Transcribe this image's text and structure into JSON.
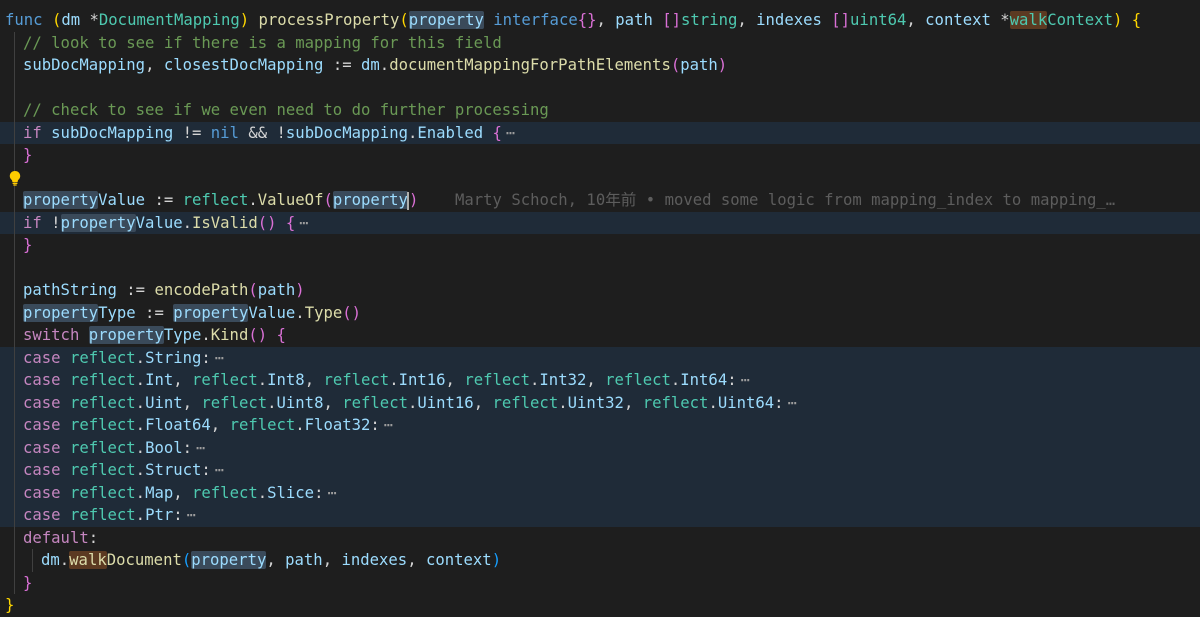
{
  "editor": {
    "lines": [
      {
        "segments": [
          {
            "t": "func ",
            "c": "kw"
          },
          {
            "t": "(",
            "c": "p1"
          },
          {
            "t": "dm ",
            "c": "var"
          },
          {
            "t": "*",
            "c": "op"
          },
          {
            "t": "DocumentMapping",
            "c": "ty"
          },
          {
            "t": ") ",
            "c": "p1"
          },
          {
            "t": "processProperty",
            "c": "fn"
          },
          {
            "t": "(",
            "c": "p1"
          },
          {
            "t": "property",
            "c": "var sel"
          },
          {
            "t": " interface",
            "c": "kw"
          },
          {
            "t": "{}",
            "c": "p2"
          },
          {
            "t": ", ",
            "c": "op"
          },
          {
            "t": "path ",
            "c": "var"
          },
          {
            "t": "[]",
            "c": "p2"
          },
          {
            "t": "string",
            "c": "ty"
          },
          {
            "t": ", ",
            "c": "op"
          },
          {
            "t": "indexes ",
            "c": "var"
          },
          {
            "t": "[]",
            "c": "p2"
          },
          {
            "t": "uint64",
            "c": "ty"
          },
          {
            "t": ", ",
            "c": "op"
          },
          {
            "t": "context ",
            "c": "var"
          },
          {
            "t": "*",
            "c": "op"
          },
          {
            "t": "walk",
            "c": "ty sel2"
          },
          {
            "t": "Context",
            "c": "ty"
          },
          {
            "t": ") ",
            "c": "p1"
          },
          {
            "t": "{",
            "c": "p1"
          }
        ]
      },
      {
        "segments": [
          {
            "t": "// look to see if there is a mapping for this field",
            "c": "cm"
          }
        ]
      },
      {
        "segments": [
          {
            "t": "subDocMapping",
            "c": "var"
          },
          {
            "t": ", ",
            "c": "op"
          },
          {
            "t": "closestDocMapping",
            "c": "var"
          },
          {
            "t": " := ",
            "c": "op"
          },
          {
            "t": "dm",
            "c": "var"
          },
          {
            "t": ".",
            "c": "op"
          },
          {
            "t": "documentMappingForPathElements",
            "c": "fn"
          },
          {
            "t": "(",
            "c": "p2"
          },
          {
            "t": "path",
            "c": "var"
          },
          {
            "t": ")",
            "c": "p2"
          }
        ]
      },
      {
        "segments": []
      },
      {
        "segments": [
          {
            "t": "// check to see if we even need to do further processing",
            "c": "cm"
          }
        ]
      },
      {
        "fold": true,
        "segments": [
          {
            "t": "if ",
            "c": "ctl"
          },
          {
            "t": "subDocMapping",
            "c": "var"
          },
          {
            "t": " != ",
            "c": "op"
          },
          {
            "t": "nil",
            "c": "kw"
          },
          {
            "t": " && !",
            "c": "op"
          },
          {
            "t": "subDocMapping",
            "c": "var"
          },
          {
            "t": ".",
            "c": "op"
          },
          {
            "t": "Enabled",
            "c": "var"
          },
          {
            "t": " {",
            "c": "p2"
          }
        ]
      },
      {
        "segments": [
          {
            "t": "}",
            "c": "p2"
          }
        ]
      },
      {
        "bulb": true,
        "segments": []
      },
      {
        "blame": "Marty Schoch, 10年前 • moved some logic from mapping_index to mapping_…",
        "segments": [
          {
            "t": "property",
            "c": "var sel"
          },
          {
            "t": "Value",
            "c": "var"
          },
          {
            "t": " := ",
            "c": "op"
          },
          {
            "t": "reflect",
            "c": "ty"
          },
          {
            "t": ".",
            "c": "op"
          },
          {
            "t": "ValueOf",
            "c": "fn"
          },
          {
            "t": "(",
            "c": "p2"
          },
          {
            "t": "property",
            "c": "var sel"
          },
          {
            "t": ")",
            "c": "p2"
          }
        ]
      },
      {
        "fold": true,
        "segments": [
          {
            "t": "if ",
            "c": "ctl"
          },
          {
            "t": "!",
            "c": "op"
          },
          {
            "t": "property",
            "c": "var sel"
          },
          {
            "t": "Value",
            "c": "var"
          },
          {
            "t": ".",
            "c": "op"
          },
          {
            "t": "IsValid",
            "c": "fn"
          },
          {
            "t": "()",
            "c": "p2"
          },
          {
            "t": " {",
            "c": "p2"
          }
        ]
      },
      {
        "segments": [
          {
            "t": "}",
            "c": "p2"
          }
        ]
      },
      {
        "segments": []
      },
      {
        "segments": [
          {
            "t": "pathString",
            "c": "var"
          },
          {
            "t": " := ",
            "c": "op"
          },
          {
            "t": "encodePath",
            "c": "fn"
          },
          {
            "t": "(",
            "c": "p2"
          },
          {
            "t": "path",
            "c": "var"
          },
          {
            "t": ")",
            "c": "p2"
          }
        ]
      },
      {
        "segments": [
          {
            "t": "property",
            "c": "var sel"
          },
          {
            "t": "Type",
            "c": "var"
          },
          {
            "t": " := ",
            "c": "op"
          },
          {
            "t": "property",
            "c": "var sel"
          },
          {
            "t": "Value",
            "c": "var"
          },
          {
            "t": ".",
            "c": "op"
          },
          {
            "t": "Type",
            "c": "fn"
          },
          {
            "t": "()",
            "c": "p2"
          }
        ]
      },
      {
        "segments": [
          {
            "t": "switch ",
            "c": "ctl"
          },
          {
            "t": "property",
            "c": "var sel"
          },
          {
            "t": "Type",
            "c": "var"
          },
          {
            "t": ".",
            "c": "op"
          },
          {
            "t": "Kind",
            "c": "fn"
          },
          {
            "t": "()",
            "c": "p2"
          },
          {
            "t": " {",
            "c": "p2"
          }
        ]
      },
      {
        "fold": true,
        "segments": [
          {
            "t": "case ",
            "c": "ctl"
          },
          {
            "t": "reflect",
            "c": "ty"
          },
          {
            "t": ".",
            "c": "op"
          },
          {
            "t": "String",
            "c": "var"
          },
          {
            "t": ":",
            "c": "op"
          }
        ]
      },
      {
        "fold": true,
        "segments": [
          {
            "t": "case ",
            "c": "ctl"
          },
          {
            "t": "reflect",
            "c": "ty"
          },
          {
            "t": ".",
            "c": "op"
          },
          {
            "t": "Int",
            "c": "var"
          },
          {
            "t": ", ",
            "c": "op"
          },
          {
            "t": "reflect",
            "c": "ty"
          },
          {
            "t": ".",
            "c": "op"
          },
          {
            "t": "Int8",
            "c": "var"
          },
          {
            "t": ", ",
            "c": "op"
          },
          {
            "t": "reflect",
            "c": "ty"
          },
          {
            "t": ".",
            "c": "op"
          },
          {
            "t": "Int16",
            "c": "var"
          },
          {
            "t": ", ",
            "c": "op"
          },
          {
            "t": "reflect",
            "c": "ty"
          },
          {
            "t": ".",
            "c": "op"
          },
          {
            "t": "Int32",
            "c": "var"
          },
          {
            "t": ", ",
            "c": "op"
          },
          {
            "t": "reflect",
            "c": "ty"
          },
          {
            "t": ".",
            "c": "op"
          },
          {
            "t": "Int64",
            "c": "var"
          },
          {
            "t": ":",
            "c": "op"
          }
        ]
      },
      {
        "fold": true,
        "segments": [
          {
            "t": "case ",
            "c": "ctl"
          },
          {
            "t": "reflect",
            "c": "ty"
          },
          {
            "t": ".",
            "c": "op"
          },
          {
            "t": "Uint",
            "c": "var"
          },
          {
            "t": ", ",
            "c": "op"
          },
          {
            "t": "reflect",
            "c": "ty"
          },
          {
            "t": ".",
            "c": "op"
          },
          {
            "t": "Uint8",
            "c": "var"
          },
          {
            "t": ", ",
            "c": "op"
          },
          {
            "t": "reflect",
            "c": "ty"
          },
          {
            "t": ".",
            "c": "op"
          },
          {
            "t": "Uint16",
            "c": "var"
          },
          {
            "t": ", ",
            "c": "op"
          },
          {
            "t": "reflect",
            "c": "ty"
          },
          {
            "t": ".",
            "c": "op"
          },
          {
            "t": "Uint32",
            "c": "var"
          },
          {
            "t": ", ",
            "c": "op"
          },
          {
            "t": "reflect",
            "c": "ty"
          },
          {
            "t": ".",
            "c": "op"
          },
          {
            "t": "Uint64",
            "c": "var"
          },
          {
            "t": ":",
            "c": "op"
          }
        ]
      },
      {
        "fold": true,
        "segments": [
          {
            "t": "case ",
            "c": "ctl"
          },
          {
            "t": "reflect",
            "c": "ty"
          },
          {
            "t": ".",
            "c": "op"
          },
          {
            "t": "Float64",
            "c": "var"
          },
          {
            "t": ", ",
            "c": "op"
          },
          {
            "t": "reflect",
            "c": "ty"
          },
          {
            "t": ".",
            "c": "op"
          },
          {
            "t": "Float32",
            "c": "var"
          },
          {
            "t": ":",
            "c": "op"
          }
        ]
      },
      {
        "fold": true,
        "segments": [
          {
            "t": "case ",
            "c": "ctl"
          },
          {
            "t": "reflect",
            "c": "ty"
          },
          {
            "t": ".",
            "c": "op"
          },
          {
            "t": "Bool",
            "c": "var"
          },
          {
            "t": ":",
            "c": "op"
          }
        ]
      },
      {
        "fold": true,
        "segments": [
          {
            "t": "case ",
            "c": "ctl"
          },
          {
            "t": "reflect",
            "c": "ty"
          },
          {
            "t": ".",
            "c": "op"
          },
          {
            "t": "Struct",
            "c": "var"
          },
          {
            "t": ":",
            "c": "op"
          }
        ]
      },
      {
        "fold": true,
        "segments": [
          {
            "t": "case ",
            "c": "ctl"
          },
          {
            "t": "reflect",
            "c": "ty"
          },
          {
            "t": ".",
            "c": "op"
          },
          {
            "t": "Map",
            "c": "var"
          },
          {
            "t": ", ",
            "c": "op"
          },
          {
            "t": "reflect",
            "c": "ty"
          },
          {
            "t": ".",
            "c": "op"
          },
          {
            "t": "Slice",
            "c": "var"
          },
          {
            "t": ":",
            "c": "op"
          }
        ]
      },
      {
        "fold": true,
        "segments": [
          {
            "t": "case ",
            "c": "ctl"
          },
          {
            "t": "reflect",
            "c": "ty"
          },
          {
            "t": ".",
            "c": "op"
          },
          {
            "t": "Ptr",
            "c": "var"
          },
          {
            "t": ":",
            "c": "op"
          }
        ]
      },
      {
        "segments": [
          {
            "t": "default",
            "c": "ctl"
          },
          {
            "t": ":",
            "c": "op"
          }
        ]
      },
      {
        "segments": [
          {
            "t": "dm",
            "c": "var"
          },
          {
            "t": ".",
            "c": "op"
          },
          {
            "t": "walk",
            "c": "fn sel2"
          },
          {
            "t": "Document",
            "c": "fn"
          },
          {
            "t": "(",
            "c": "p3"
          },
          {
            "t": "property",
            "c": "var sel"
          },
          {
            "t": ", ",
            "c": "op"
          },
          {
            "t": "path",
            "c": "var"
          },
          {
            "t": ", ",
            "c": "op"
          },
          {
            "t": "indexes",
            "c": "var"
          },
          {
            "t": ", ",
            "c": "op"
          },
          {
            "t": "context",
            "c": "var"
          },
          {
            "t": ")",
            "c": "p3"
          }
        ]
      },
      {
        "segments": [
          {
            "t": "}",
            "c": "p2"
          }
        ]
      },
      {
        "segments": [
          {
            "t": "}",
            "c": "p1"
          }
        ]
      }
    ],
    "fold_glyph": "⋯",
    "colors": {
      "background": "#1e1e1e",
      "highlight": "#1f2b38",
      "keyword": "#569cd6",
      "control": "#c586c0",
      "function": "#dcdcaa",
      "type": "#4ec9b0",
      "variable": "#9cdcfe",
      "comment": "#6a9955"
    }
  }
}
